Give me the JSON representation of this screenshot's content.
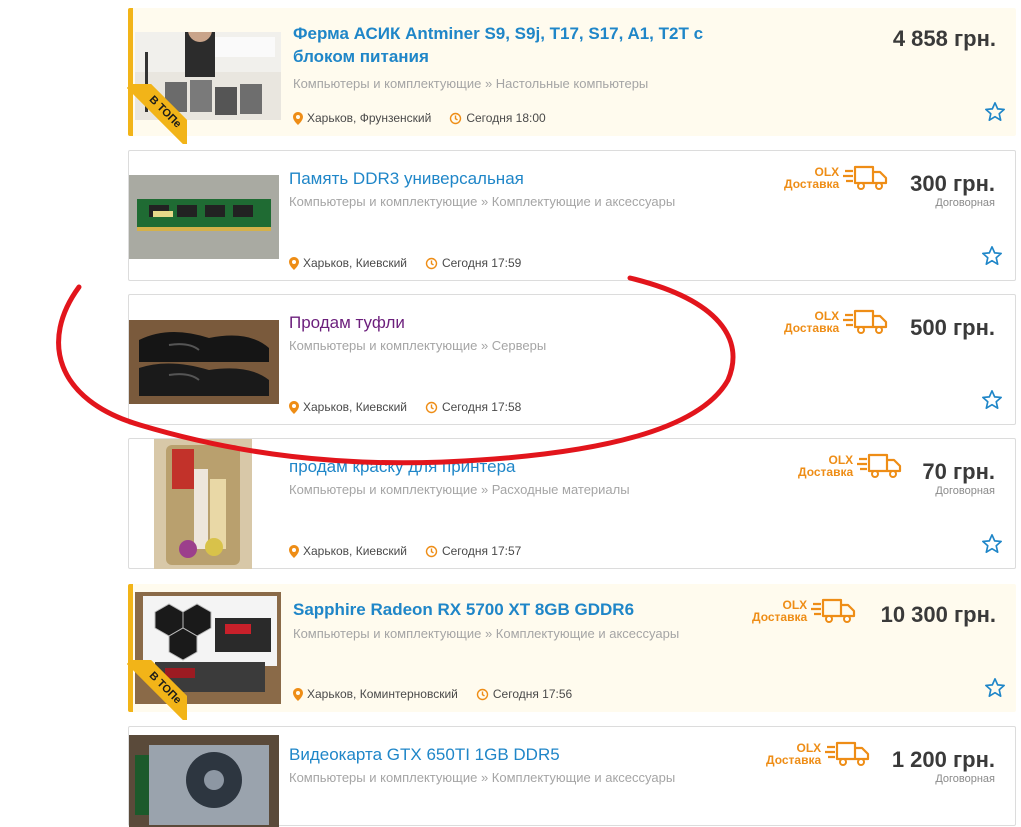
{
  "colors": {
    "accent": "#1f86c8",
    "top": "#f2b418",
    "delivery": "#ee8d16",
    "annotation": "#e2151c"
  },
  "listings": [
    {
      "title": "Ферма АСИК Antminer S9, S9j, T17, S17, A1, T2T с блоком питания",
      "category": "Компьютеры и комплектующие » Настольные компьютеры",
      "location": "Харьков, Фрунзенский",
      "time": "Сегодня 18:00",
      "price": "4 858 грн.",
      "badge": "В ТОПе",
      "image": "asic-miners-photo"
    },
    {
      "title": "Память DDR3 универсальная",
      "category": "Компьютеры и комплектующие » Комплектующие и аксессуары",
      "location": "Харьков, Киевский",
      "time": "Сегодня 17:59",
      "price": "300 грн.",
      "negotiable": "Договорная",
      "delivery_olx": "OLX",
      "delivery_label": "Доставка",
      "image": "ram-stick-photo"
    },
    {
      "title": "Продам туфли",
      "category": "Компьютеры и комплектующие » Серверы",
      "location": "Харьков, Киевский",
      "time": "Сегодня 17:58",
      "price": "500 грн.",
      "delivery_olx": "OLX",
      "delivery_label": "Доставка",
      "image": "black-shoes-photo"
    },
    {
      "title": "продам краску для принтера",
      "category": "Компьютеры и комплектующие » Расходные материалы",
      "location": "Харьков, Киевский",
      "time": "Сегодня 17:57",
      "price": "70 грн.",
      "negotiable": "Договорная",
      "delivery_olx": "OLX",
      "delivery_label": "Доставка",
      "image": "printer-ink-photo"
    },
    {
      "title": "Sapphire Radeon RX 5700 XT 8GB GDDR6",
      "category": "Компьютеры и комплектующие » Комплектующие и аксессуары",
      "location": "Харьков, Коминтерновский",
      "time": "Сегодня 17:56",
      "price": "10 300 грн.",
      "badge": "В ТОПе",
      "delivery_olx": "OLX",
      "delivery_label": "Доставка",
      "image": "gpu-box-photo"
    },
    {
      "title": "Видеокарта GTX 650TI 1GB DDR5",
      "category": "Компьютеры и комплектующие » Комплектующие и аксессуары",
      "price": "1 200 грн.",
      "negotiable": "Договорная",
      "delivery_olx": "OLX",
      "delivery_label": "Доставка",
      "image": "gpu-card-photo"
    }
  ],
  "icons": {
    "location": "location-pin-icon",
    "time": "clock-history-icon",
    "favorite": "star-outline-icon",
    "truck": "delivery-truck-icon"
  }
}
